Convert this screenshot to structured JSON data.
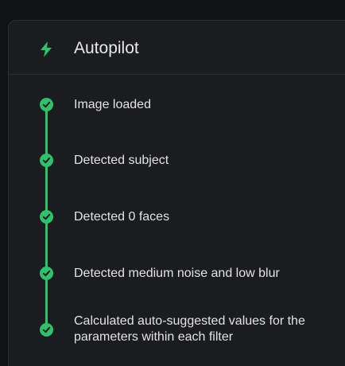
{
  "panel": {
    "title": "Autopilot",
    "icon": "lightning-bolt-icon",
    "accent_color": "#2cc46b"
  },
  "steps": [
    {
      "label": "Image loaded",
      "status": "complete"
    },
    {
      "label": "Detected subject",
      "status": "complete"
    },
    {
      "label": "Detected 0 faces",
      "status": "complete"
    },
    {
      "label": "Detected medium noise and low blur",
      "status": "complete"
    },
    {
      "label": "Calculated auto-suggested values for the parameters within each filter",
      "status": "complete"
    }
  ]
}
